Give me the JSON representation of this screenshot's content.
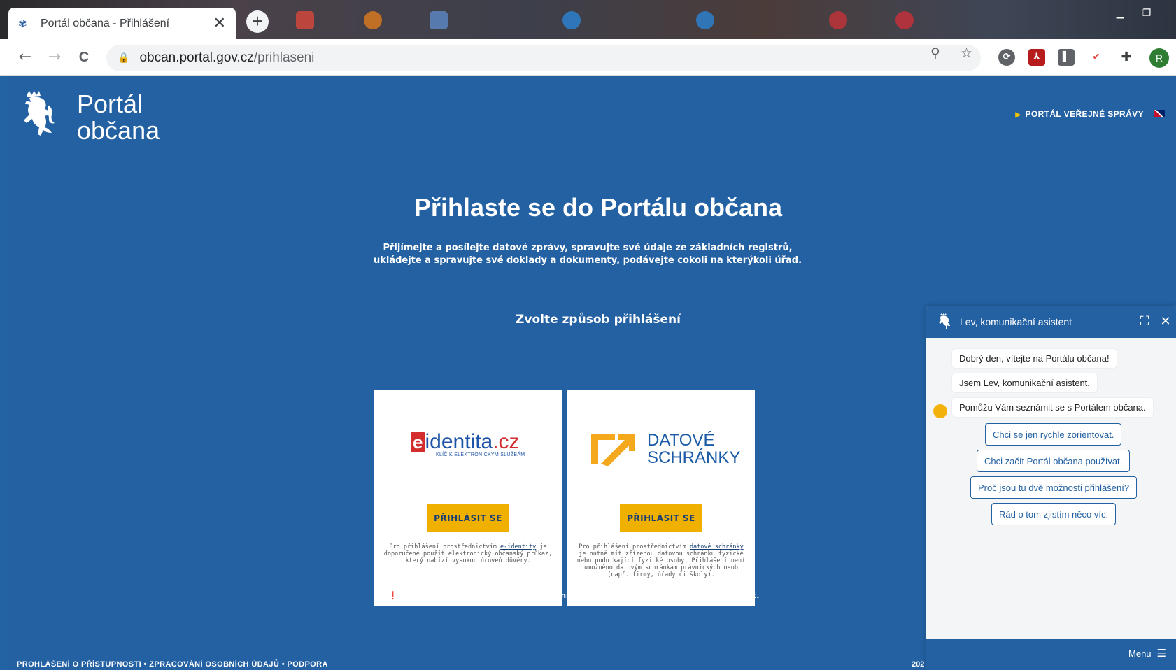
{
  "browser": {
    "tab_title": "Portál občana - Přihlášení",
    "tab_close": "✕",
    "newtab": "+",
    "nav_back": "←",
    "nav_forward": "→",
    "nav_reload": "C",
    "url_host": "obcan.portal.gov.cz",
    "url_path": "/prihlaseni",
    "profile_initial": "R"
  },
  "header": {
    "brand_line1": "Portál",
    "brand_line2": "občana",
    "portal_link": "PORTÁL VEŘEJNÉ SPRÁVY"
  },
  "hero": {
    "title": "Přihlaste se do Portálu občana",
    "subtitle": "Přijímejte a posílejte datové zprávy, spravujte své údaje ze základních registrů, ukládejte a spravujte své doklady a dokumenty, podávejte cokoli na kterýkoli úřad.",
    "choose": "Zvolte způsob přihlášení"
  },
  "cards": {
    "eidentita": {
      "logo_e": "e",
      "logo_word": "identita",
      "logo_cz": ".cz",
      "logo_tag": "KLÍČ K ELEKTRONICKÝM SLUŽBÁM",
      "button": "PŘIHLÁSIT SE",
      "note_before": "Pro přihlášení prostřednictvím ",
      "note_link": "e-identity",
      "note_after": " je doporučené použít elektronický občanský průkaz, který nabízí vysokou úroveň důvěry."
    },
    "datovky": {
      "logo_line1": "DATOVÉ",
      "logo_line2": "SCHRÁNKY",
      "button": "PŘIHLÁSIT SE",
      "note_before": "Pro přihlášení prostřednictvím ",
      "note_link": "datové schránky",
      "note_after": " je nutné mít zřízenou datovou schránku fyzické nebo podnikající fyzické osoby. Přihlášení není umožněno datovým schránkám právnických osob (např. firmy, úřady či školy)."
    }
  },
  "footer": {
    "warning": "Chraňte své osobní údaje. Po ukončení práce s portálem se nezapomeňte odhlásit.",
    "links": "PROHLÁŠENÍ O PŘÍSTUPNOSTI • ZPRACOVÁNÍ OSOBNÍCH ÚDAJŮ • PODPORA",
    "year": "202"
  },
  "chat": {
    "title": "Lev, komunikační asistent",
    "messages": [
      "Dobrý den, vítejte na Portálu občana!",
      "Jsem Lev, komunikační asistent.",
      "Pomůžu Vám seznámit se s Portálem občana."
    ],
    "options": [
      "Chci se jen rychle zorientovat.",
      "Chci začít Portál občana používat.",
      "Proč jsou tu dvě možnosti přihlášení?",
      "Rád o tom zjistím něco víc."
    ],
    "menu": "Menu"
  }
}
